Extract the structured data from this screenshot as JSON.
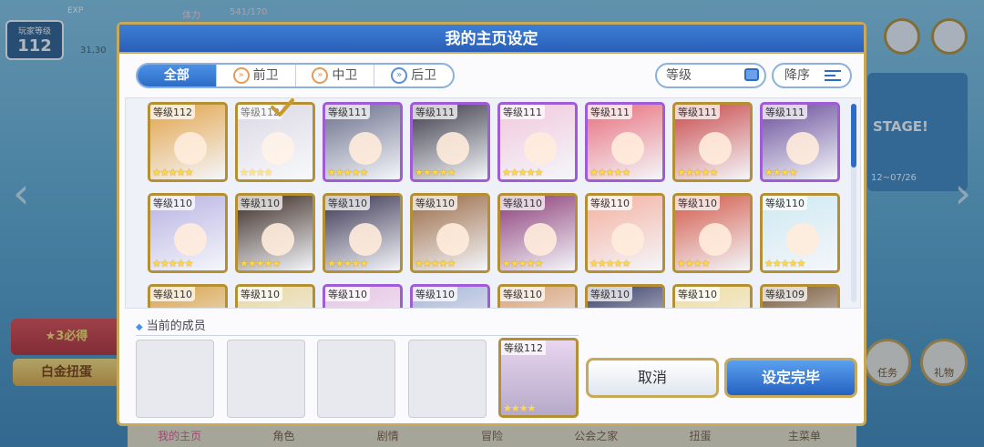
{
  "hud": {
    "player_level_label": "玩家等级",
    "player_level": "112",
    "exp_label": "EXP",
    "stamina_label": "体力",
    "stamina_value": "541/170",
    "coins": "31,30"
  },
  "background": {
    "event_stage_text": "STAGE!",
    "event_date": "12~07/26",
    "gacha_badge": "★3必得",
    "gacha_label": "白金扭蛋",
    "task_label": "任务",
    "gift_label": "礼物",
    "nav": [
      "我的主页",
      "角色",
      "剧情",
      "冒险",
      "公会之家",
      "扭蛋",
      "主菜单"
    ]
  },
  "dialog": {
    "title": "我的主页设定",
    "tabs": [
      "全部",
      "前卫",
      "中卫",
      "后卫"
    ],
    "sort_by": "等级",
    "sort_order": "降序",
    "members_label": "当前的成员",
    "cancel_label": "取消",
    "confirm_label": "设定完毕",
    "current_member": {
      "level": "等级112",
      "stars": "★★★★"
    }
  },
  "characters": [
    {
      "level": "等级112",
      "stars": "★★★★★",
      "color": "#e3a44a",
      "frame": "gold"
    },
    {
      "level": "等级112",
      "stars": "★★★★",
      "color": "#c9c3d6",
      "frame": "gold",
      "selected": true
    },
    {
      "level": "等级111",
      "stars": "★★★★★",
      "color": "#6b6f8a",
      "frame": "purple"
    },
    {
      "level": "等级111",
      "stars": "★★★★★",
      "color": "#3c3a48",
      "frame": "purple"
    },
    {
      "level": "等级111",
      "stars": "★★★★★",
      "color": "#f2c8dd",
      "frame": "purple"
    },
    {
      "level": "等级111",
      "stars": "★★★★★",
      "color": "#e86f7c",
      "frame": "purple"
    },
    {
      "level": "等级111",
      "stars": "★★★★★",
      "color": "#c94a4a",
      "frame": "gold"
    },
    {
      "level": "等级111",
      "stars": "★★★★",
      "color": "#6a4f9a",
      "frame": "purple"
    },
    {
      "level": "等级110",
      "stars": "★★★★★",
      "color": "#b9b2e3",
      "frame": "gold"
    },
    {
      "level": "等级110",
      "stars": "★★★★★",
      "color": "#3b2a23",
      "frame": "gold"
    },
    {
      "level": "等级110",
      "stars": "★★★★★",
      "color": "#3a3452",
      "frame": "gold"
    },
    {
      "level": "等级110",
      "stars": "★★★★★",
      "color": "#9a6a46",
      "frame": "gold"
    },
    {
      "level": "等级110",
      "stars": "★★★★★",
      "color": "#8b3c78",
      "frame": "gold"
    },
    {
      "level": "等级110",
      "stars": "★★★★★",
      "color": "#f5b0a0",
      "frame": "gold"
    },
    {
      "level": "等级110",
      "stars": "★★★★",
      "color": "#d35a4a",
      "frame": "gold"
    },
    {
      "level": "等级110",
      "stars": "★★★★★",
      "color": "#cfe9f2",
      "frame": "gold"
    },
    {
      "level": "等级110",
      "stars": "",
      "color": "#d9a34a",
      "frame": "gold"
    },
    {
      "level": "等级110",
      "stars": "",
      "color": "#e8d7a2",
      "frame": "gold"
    },
    {
      "level": "等级110",
      "stars": "",
      "color": "#e7c3e2",
      "frame": "purple"
    },
    {
      "level": "等级110",
      "stars": "",
      "color": "#a9b7d8",
      "frame": "purple"
    },
    {
      "level": "等级110",
      "stars": "",
      "color": "#d9a37a",
      "frame": "gold"
    },
    {
      "level": "等级110",
      "stars": "",
      "color": "#3b3f68",
      "frame": "gold"
    },
    {
      "level": "等级110",
      "stars": "",
      "color": "#f0dca0",
      "frame": "gold"
    },
    {
      "level": "等级109",
      "stars": "",
      "color": "#7a5a3a",
      "frame": "gold"
    }
  ]
}
